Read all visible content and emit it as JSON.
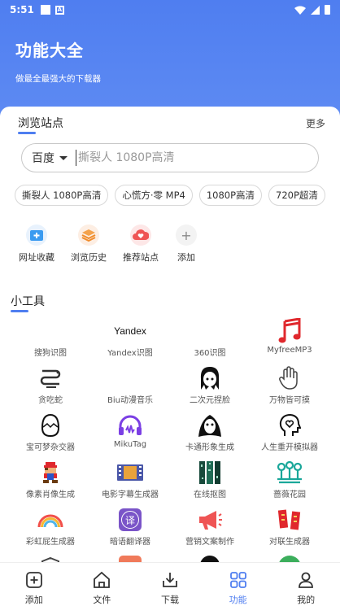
{
  "status": {
    "time": "5:51"
  },
  "header": {
    "title": "功能大全",
    "subtitle": "做最全最强大的下载器"
  },
  "browse": {
    "title": "浏览站点",
    "more": "更多",
    "engine": "百度",
    "placeholder": "撕裂人 1080P高清",
    "chips": [
      "撕裂人 1080P高清",
      "心慌方·零 MP4",
      "1080P高清",
      "720P超清"
    ],
    "quick": [
      {
        "label": "网址收藏",
        "icon": "bookmark-add-icon"
      },
      {
        "label": "浏览历史",
        "icon": "layers-icon"
      },
      {
        "label": "推荐站点",
        "icon": "cloud-heart-icon"
      },
      {
        "label": "添加",
        "icon": "plus-icon"
      }
    ]
  },
  "tools": {
    "title": "小工具",
    "items": [
      {
        "label": "搜狗识图",
        "icon": "sogou-icon"
      },
      {
        "label": "Yandex识图",
        "icon": "yandex-logo",
        "logo_text": "Yandex"
      },
      {
        "label": "360识图",
        "icon": "360-icon"
      },
      {
        "label": "MyfreeMP3",
        "icon": "music-note-icon"
      },
      {
        "label": "贪吃蛇",
        "icon": "snake-icon"
      },
      {
        "label": "Biu动漫音乐",
        "icon": "biu-icon"
      },
      {
        "label": "二次元捏脸",
        "icon": "anime-face-icon"
      },
      {
        "label": "万物皆可摸",
        "icon": "hand-icon"
      },
      {
        "label": "宝可梦杂交器",
        "icon": "egg-icon"
      },
      {
        "label": "MikuTag",
        "icon": "headphones-icon"
      },
      {
        "label": "卡通形象生成",
        "icon": "ghost-icon"
      },
      {
        "label": "人生重开模拟器",
        "icon": "heart-head-icon"
      },
      {
        "label": "像素肖像生成",
        "icon": "pixel-mario-icon"
      },
      {
        "label": "电影字幕生成器",
        "icon": "film-icon"
      },
      {
        "label": "在线抠图",
        "icon": "cutout-icon"
      },
      {
        "label": "蔷薇花园",
        "icon": "garden-icon"
      },
      {
        "label": "彩虹屁生成器",
        "icon": "rainbow-icon"
      },
      {
        "label": "暗语翻译器",
        "icon": "translate-icon",
        "glyph": "译"
      },
      {
        "label": "营销文案制作",
        "icon": "megaphone-icon"
      },
      {
        "label": "对联生成器",
        "icon": "couplet-icon"
      }
    ]
  },
  "nav": [
    {
      "label": "添加",
      "icon": "add-icon",
      "active": false
    },
    {
      "label": "文件",
      "icon": "home-icon",
      "active": false
    },
    {
      "label": "下载",
      "icon": "download-icon",
      "active": false
    },
    {
      "label": "功能",
      "icon": "apps-icon",
      "active": true
    },
    {
      "label": "我的",
      "icon": "profile-icon",
      "active": false
    }
  ],
  "colors": {
    "accent": "#4f7ef0",
    "header": "#5a87f2"
  }
}
